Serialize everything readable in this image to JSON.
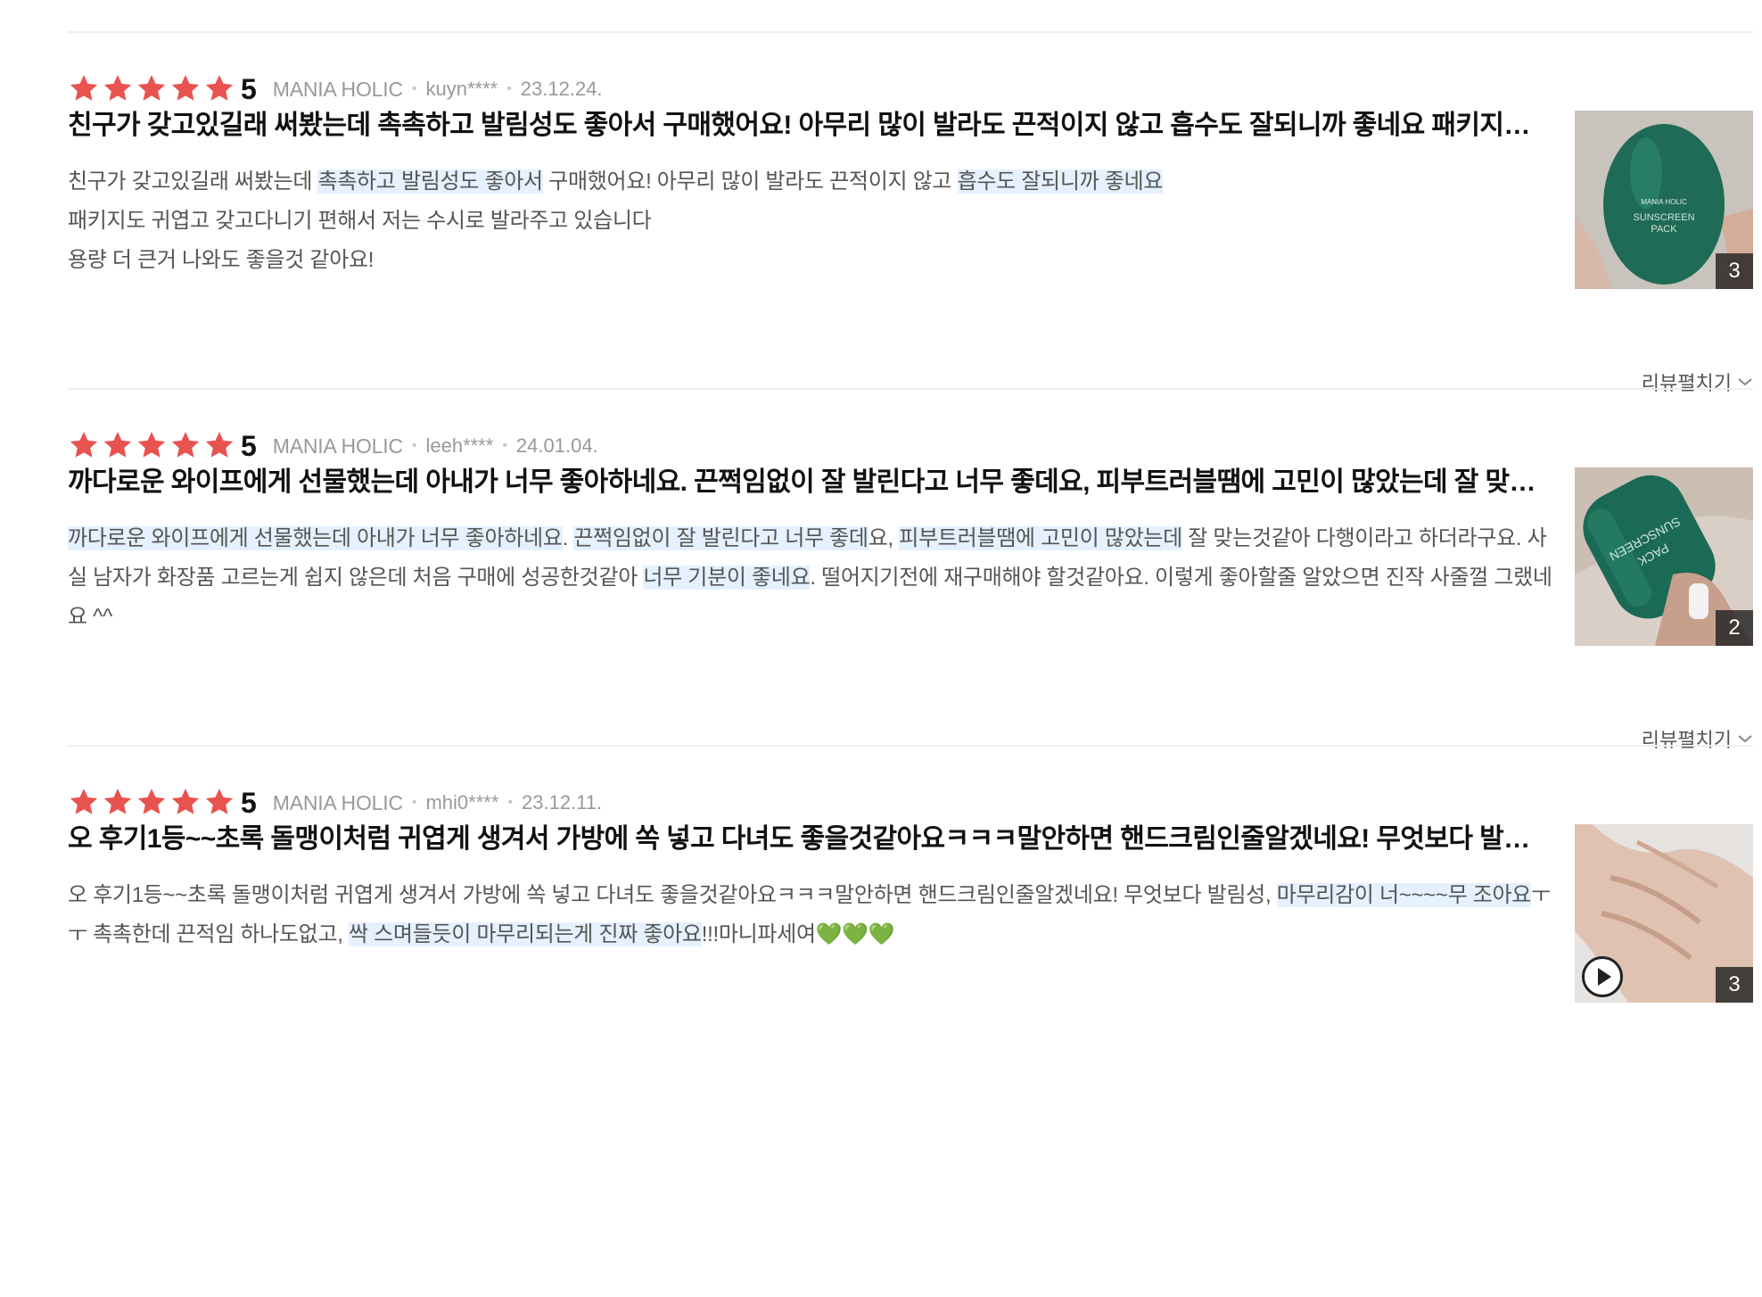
{
  "colors": {
    "star": "#e8524f",
    "highlight": "#e5f1ff",
    "text_muted": "#999999",
    "divider": "#eeeeee"
  },
  "reviews": [
    {
      "stars": 5,
      "score": "5",
      "brand": "MANIA HOLIC",
      "user": "kuyn****",
      "date": "23.12.24.",
      "title": "친구가 갖고있길래 써봤는데 촉촉하고 발림성도 좋아서 구매했어요! 아무리 많이 발라도 끈적이지 않고 흡수도 잘되니까 좋네요 패키지도 귀엽고 갖고다니기 편해서",
      "body": [
        {
          "t": "친구가 갖고있길래 써봤는데 ",
          "h": false
        },
        {
          "t": "촉촉하고 발림성도 좋아서",
          "h": true
        },
        {
          "t": " 구매했어요! 아무리 많이 발라도 끈적이지 않고 ",
          "h": false
        },
        {
          "t": "흡수도 잘되니까 좋네요",
          "h": true
        },
        {
          "t": "\n패키지도 귀엽고 갖고다니기 편해서 저는 수시로 발라주고 있습니다\n용량 더 큰거 나와도 좋을것 같아요!",
          "h": false
        }
      ],
      "photo_count": "3",
      "photo_icon": "green-sunscreen-egg",
      "expand_label": "리뷰펼치기"
    },
    {
      "stars": 5,
      "score": "5",
      "brand": "MANIA HOLIC",
      "user": "leeh****",
      "date": "24.01.04.",
      "title": "까다로운 와이프에게 선물했는데 아내가 너무 좋아하네요. 끈쩍임없이 잘 발린다고 너무 좋데요, 피부트러블땜에 고민이 많았는데 잘 맞는것같아",
      "body": [
        {
          "t": "까다로운 와이프에게 선물했는데 아내가 너무 좋아하네요",
          "h": true
        },
        {
          "t": ". ",
          "h": false
        },
        {
          "t": "끈쩍임없이 잘 발린다고 너무 좋데",
          "h": true
        },
        {
          "t": "요, ",
          "h": false
        },
        {
          "t": "피부트러블땜에 고민이 많았는데",
          "h": true
        },
        {
          "t": " 잘 맞는것같아 다행이라고 하더라구요. 사실 남자가 화장품 고르는게 쉽지 않은데 처음 구매에 성공한것같아 ",
          "h": false
        },
        {
          "t": "너무 기분이 좋네요",
          "h": true
        },
        {
          "t": ". 떨어지기전에 재구매해야 할것같아요. 이렇게 좋아할줄 알았으면 진작 사줄껄 그랬네요 ^^",
          "h": false
        }
      ],
      "photo_count": "2",
      "photo_icon": "sunscreen-pack-tube",
      "expand_label": "리뷰펼치기"
    },
    {
      "stars": 5,
      "score": "5",
      "brand": "MANIA HOLIC",
      "user": "mhi0****",
      "date": "23.12.11.",
      "title": "오 후기1등~~초록 돌맹이처럼 귀엽게 생겨서 가방에 쏙 넣고 다녀도 좋을것같아요ㅋㅋㅋ말안하면 핸드크림인줄알겠네요! 무엇보다 발림성",
      "body": [
        {
          "t": "오 후기1등~~초록 돌맹이처럼 귀엽게 생겨서 가방에 쏙 넣고 다녀도 좋을것같아요ㅋㅋㅋ말안하면 핸드크림인줄알겠네요! 무엇보다 발림성, ",
          "h": false
        },
        {
          "t": "마무리감이 너~~~~무 조아요",
          "h": true
        },
        {
          "t": "ㅜㅜ 촉촉한데 끈적임 하나도없고, ",
          "h": false
        },
        {
          "t": "싹 스며들듯이 마무리되는게 진짜 좋아요",
          "h": true
        },
        {
          "t": "!!!마니파세여💚💚💚",
          "h": false
        }
      ],
      "photo_count": "3",
      "photo_icon": "hand-video",
      "expand_label": ""
    }
  ]
}
